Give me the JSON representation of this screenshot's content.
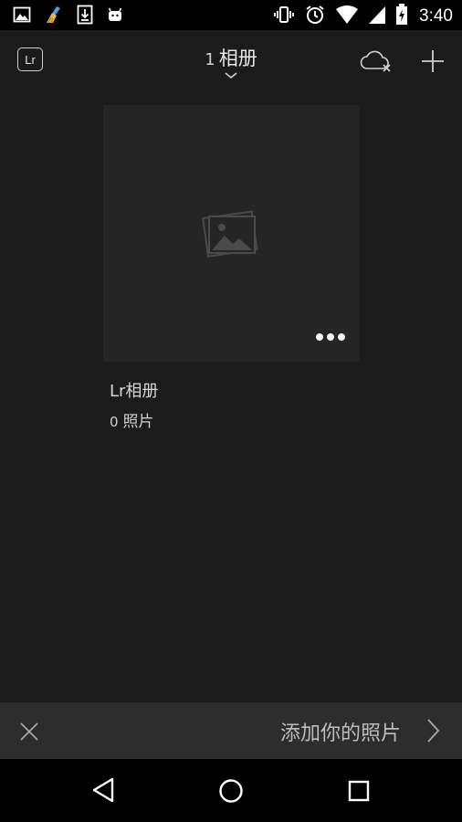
{
  "status_bar": {
    "time": "3:40",
    "left_icons": [
      "gallery-icon",
      "broom-icon",
      "download-icon",
      "android-icon"
    ],
    "right_icons": [
      "vibrate-icon",
      "alarm-icon",
      "wifi-icon",
      "signal-icon",
      "battery-charging-icon"
    ]
  },
  "app_bar": {
    "badge_label": "Lr",
    "album_count": "1",
    "title": "相册",
    "icons": [
      "chevron-down-icon",
      "cloud-off-icon",
      "plus-icon"
    ]
  },
  "album": {
    "name": "Lr相册",
    "photo_count": "0",
    "photo_label": "照片",
    "icons": [
      "image-placeholder-icon",
      "more-icon"
    ]
  },
  "banner": {
    "text": "添加你的照片",
    "icons": [
      "close-icon",
      "chevron-right-icon"
    ]
  },
  "nav_bar": {
    "icons": [
      "back-icon",
      "home-icon",
      "recents-icon"
    ]
  },
  "colors": {
    "background": "#1b1b1b",
    "card": "#252525",
    "banner": "#2d2d2d",
    "bars": "#000000"
  }
}
